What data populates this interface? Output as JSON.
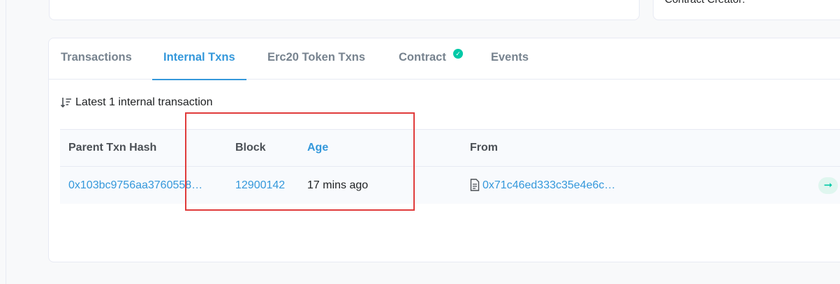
{
  "top_right_card": {
    "label": "Contract Creator:"
  },
  "tabs": [
    {
      "label": "Transactions",
      "active": false
    },
    {
      "label": "Internal Txns",
      "active": true
    },
    {
      "label": "Erc20 Token Txns",
      "active": false
    },
    {
      "label": "Contract",
      "active": false,
      "verified_icon": "check-circle-icon"
    },
    {
      "label": "Events",
      "active": false
    }
  ],
  "summary": {
    "icon": "sort-desc-icon",
    "text": "Latest 1 internal transaction"
  },
  "table": {
    "headers": {
      "parent_hash": "Parent Txn Hash",
      "block": "Block",
      "age": "Age",
      "from": "From"
    },
    "rows": [
      {
        "parent_hash": "0x103bc9756aa3760558…",
        "block": "12900142",
        "age": "17 mins ago",
        "from_icon": "contract-file-icon",
        "from": "0x71c46ed333c35e4e6c…",
        "direction_icon": "arrow-right-icon"
      }
    ]
  },
  "colors": {
    "accent": "#3498db",
    "success": "#00c9a7",
    "highlight_box": "#e03b3b"
  }
}
